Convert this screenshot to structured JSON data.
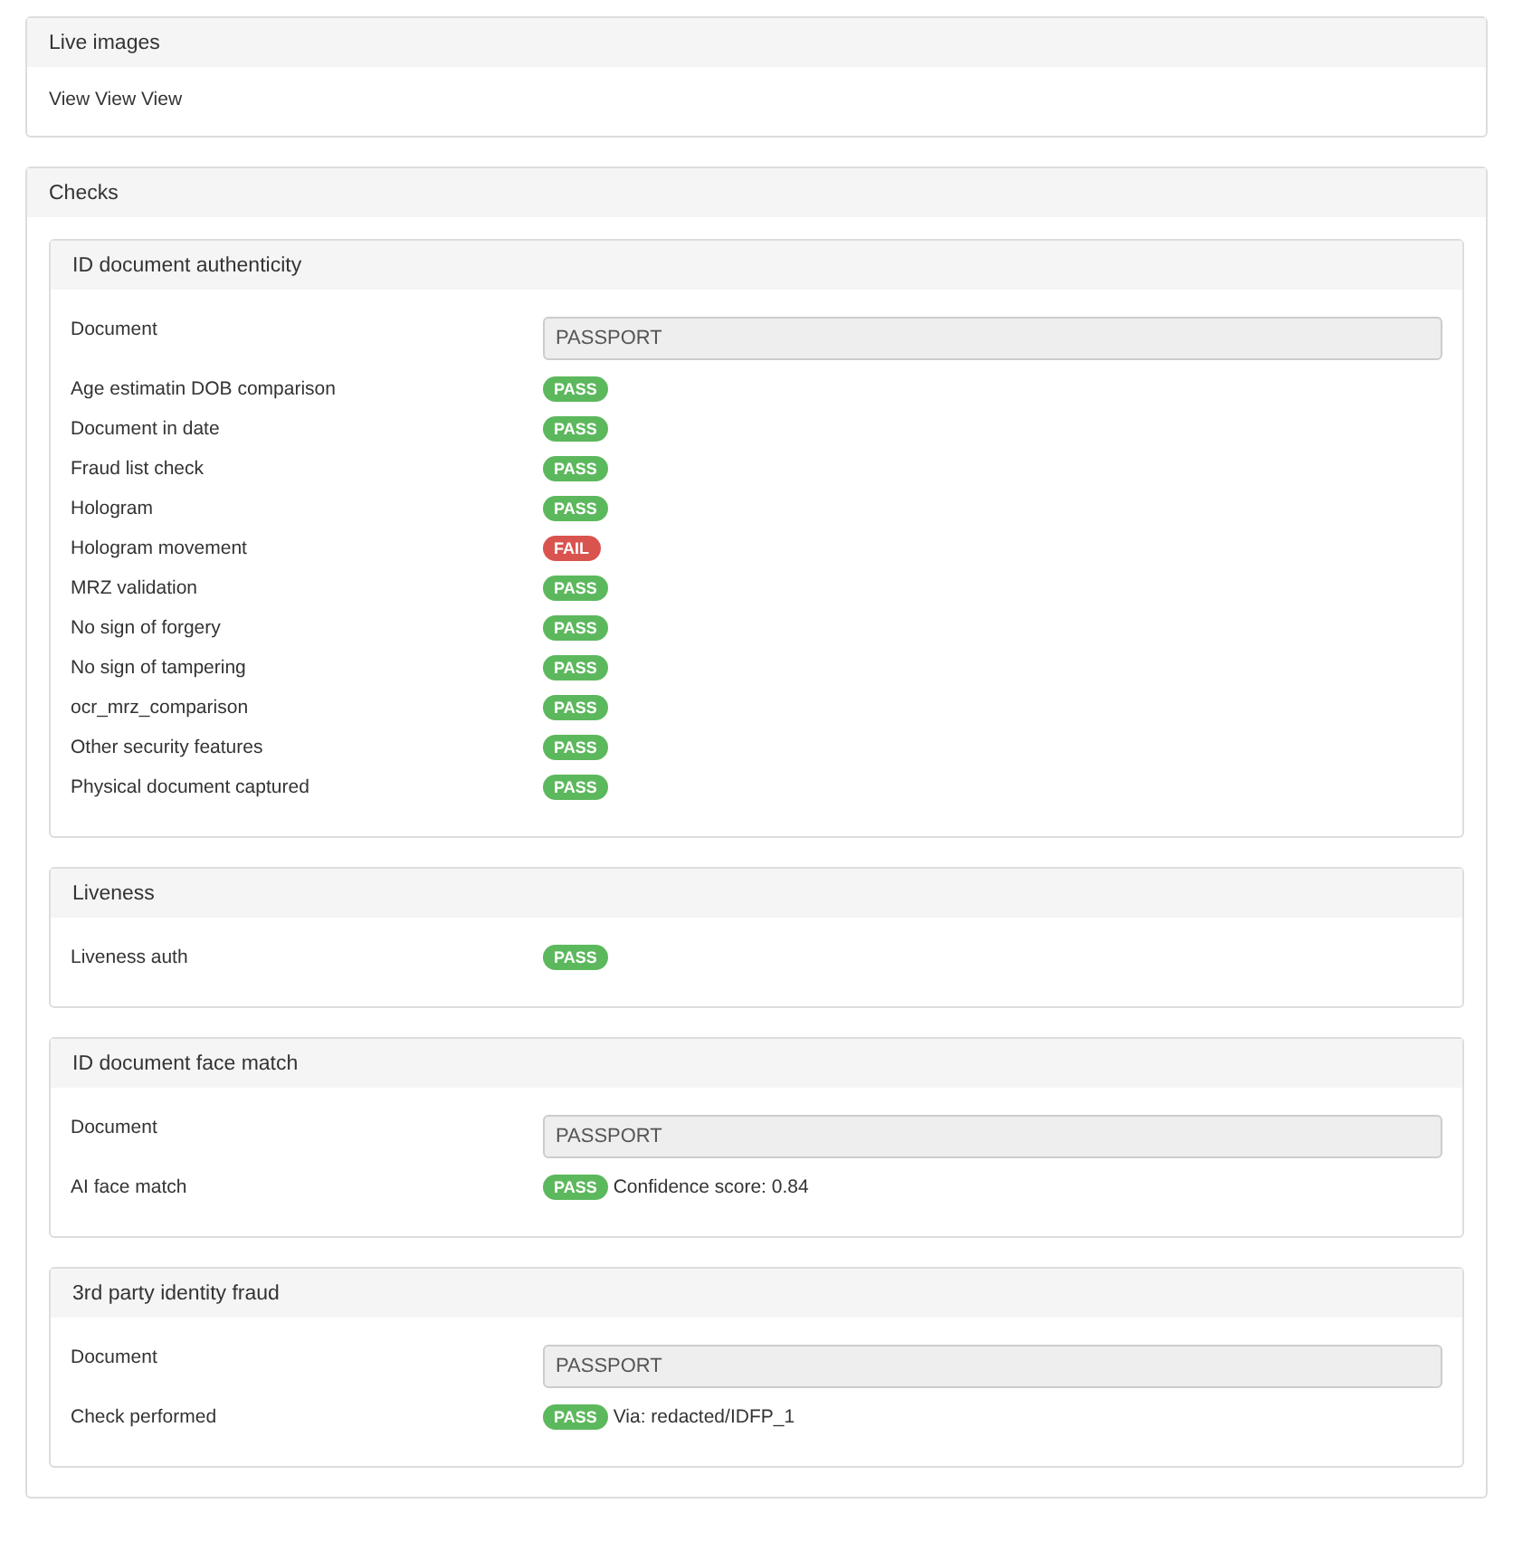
{
  "live_images": {
    "title": "Live images",
    "text": "View View View"
  },
  "checks": {
    "title": "Checks",
    "sections": [
      {
        "title": "ID document authenticity",
        "rows": [
          {
            "kind": "field",
            "label": "Document",
            "value": "PASSPORT"
          },
          {
            "kind": "badge",
            "label": "Age estimatin DOB comparison",
            "badge": "PASS",
            "passed": true
          },
          {
            "kind": "badge",
            "label": "Document in date",
            "badge": "PASS",
            "passed": true
          },
          {
            "kind": "badge",
            "label": "Fraud list check",
            "badge": "PASS",
            "passed": true
          },
          {
            "kind": "badge",
            "label": "Hologram",
            "badge": "PASS",
            "passed": true
          },
          {
            "kind": "badge",
            "label": "Hologram movement",
            "badge": "FAIL",
            "passed": false
          },
          {
            "kind": "badge",
            "label": "MRZ validation",
            "badge": "PASS",
            "passed": true
          },
          {
            "kind": "badge",
            "label": "No sign of forgery",
            "badge": "PASS",
            "passed": true
          },
          {
            "kind": "badge",
            "label": "No sign of tampering",
            "badge": "PASS",
            "passed": true
          },
          {
            "kind": "badge",
            "label": "ocr_mrz_comparison",
            "badge": "PASS",
            "passed": true
          },
          {
            "kind": "badge",
            "label": "Other security features",
            "badge": "PASS",
            "passed": true
          },
          {
            "kind": "badge",
            "label": "Physical document captured",
            "badge": "PASS",
            "passed": true
          }
        ]
      },
      {
        "title": "Liveness",
        "rows": [
          {
            "kind": "badge",
            "label": "Liveness auth",
            "badge": "PASS",
            "passed": true
          }
        ]
      },
      {
        "title": "ID document face match",
        "rows": [
          {
            "kind": "field",
            "label": "Document",
            "value": "PASSPORT"
          },
          {
            "kind": "badge",
            "label": "AI face match",
            "badge": "PASS",
            "passed": true,
            "note": "Confidence score: 0.84"
          }
        ]
      },
      {
        "title": "3rd party identity fraud",
        "rows": [
          {
            "kind": "field",
            "label": "Document",
            "value": "PASSPORT"
          },
          {
            "kind": "badge",
            "label": "Check performed",
            "badge": "PASS",
            "passed": true,
            "note": "Via: redacted/IDFP_1"
          }
        ]
      }
    ]
  }
}
